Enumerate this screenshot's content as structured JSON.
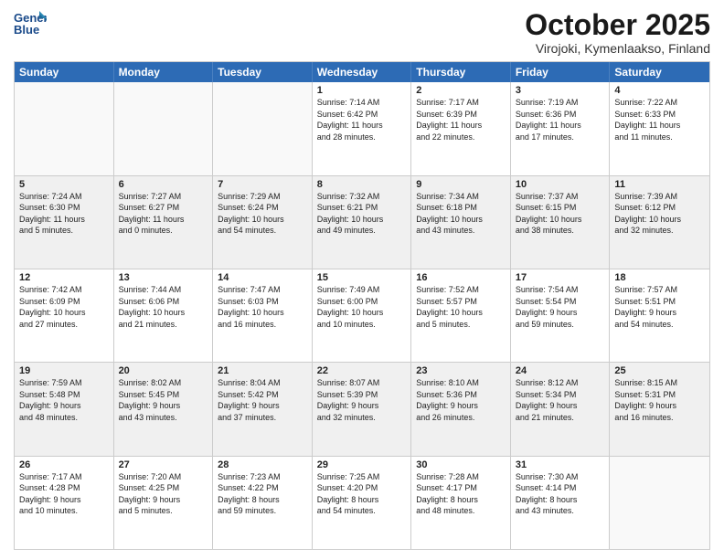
{
  "header": {
    "logo_line1": "General",
    "logo_line2": "Blue",
    "month": "October 2025",
    "location": "Virojoki, Kymenlaakso, Finland"
  },
  "days": [
    "Sunday",
    "Monday",
    "Tuesday",
    "Wednesday",
    "Thursday",
    "Friday",
    "Saturday"
  ],
  "rows": [
    [
      {
        "num": "",
        "text": ""
      },
      {
        "num": "",
        "text": ""
      },
      {
        "num": "",
        "text": ""
      },
      {
        "num": "1",
        "text": "Sunrise: 7:14 AM\nSunset: 6:42 PM\nDaylight: 11 hours\nand 28 minutes."
      },
      {
        "num": "2",
        "text": "Sunrise: 7:17 AM\nSunset: 6:39 PM\nDaylight: 11 hours\nand 22 minutes."
      },
      {
        "num": "3",
        "text": "Sunrise: 7:19 AM\nSunset: 6:36 PM\nDaylight: 11 hours\nand 17 minutes."
      },
      {
        "num": "4",
        "text": "Sunrise: 7:22 AM\nSunset: 6:33 PM\nDaylight: 11 hours\nand 11 minutes."
      }
    ],
    [
      {
        "num": "5",
        "text": "Sunrise: 7:24 AM\nSunset: 6:30 PM\nDaylight: 11 hours\nand 5 minutes."
      },
      {
        "num": "6",
        "text": "Sunrise: 7:27 AM\nSunset: 6:27 PM\nDaylight: 11 hours\nand 0 minutes."
      },
      {
        "num": "7",
        "text": "Sunrise: 7:29 AM\nSunset: 6:24 PM\nDaylight: 10 hours\nand 54 minutes."
      },
      {
        "num": "8",
        "text": "Sunrise: 7:32 AM\nSunset: 6:21 PM\nDaylight: 10 hours\nand 49 minutes."
      },
      {
        "num": "9",
        "text": "Sunrise: 7:34 AM\nSunset: 6:18 PM\nDaylight: 10 hours\nand 43 minutes."
      },
      {
        "num": "10",
        "text": "Sunrise: 7:37 AM\nSunset: 6:15 PM\nDaylight: 10 hours\nand 38 minutes."
      },
      {
        "num": "11",
        "text": "Sunrise: 7:39 AM\nSunset: 6:12 PM\nDaylight: 10 hours\nand 32 minutes."
      }
    ],
    [
      {
        "num": "12",
        "text": "Sunrise: 7:42 AM\nSunset: 6:09 PM\nDaylight: 10 hours\nand 27 minutes."
      },
      {
        "num": "13",
        "text": "Sunrise: 7:44 AM\nSunset: 6:06 PM\nDaylight: 10 hours\nand 21 minutes."
      },
      {
        "num": "14",
        "text": "Sunrise: 7:47 AM\nSunset: 6:03 PM\nDaylight: 10 hours\nand 16 minutes."
      },
      {
        "num": "15",
        "text": "Sunrise: 7:49 AM\nSunset: 6:00 PM\nDaylight: 10 hours\nand 10 minutes."
      },
      {
        "num": "16",
        "text": "Sunrise: 7:52 AM\nSunset: 5:57 PM\nDaylight: 10 hours\nand 5 minutes."
      },
      {
        "num": "17",
        "text": "Sunrise: 7:54 AM\nSunset: 5:54 PM\nDaylight: 9 hours\nand 59 minutes."
      },
      {
        "num": "18",
        "text": "Sunrise: 7:57 AM\nSunset: 5:51 PM\nDaylight: 9 hours\nand 54 minutes."
      }
    ],
    [
      {
        "num": "19",
        "text": "Sunrise: 7:59 AM\nSunset: 5:48 PM\nDaylight: 9 hours\nand 48 minutes."
      },
      {
        "num": "20",
        "text": "Sunrise: 8:02 AM\nSunset: 5:45 PM\nDaylight: 9 hours\nand 43 minutes."
      },
      {
        "num": "21",
        "text": "Sunrise: 8:04 AM\nSunset: 5:42 PM\nDaylight: 9 hours\nand 37 minutes."
      },
      {
        "num": "22",
        "text": "Sunrise: 8:07 AM\nSunset: 5:39 PM\nDaylight: 9 hours\nand 32 minutes."
      },
      {
        "num": "23",
        "text": "Sunrise: 8:10 AM\nSunset: 5:36 PM\nDaylight: 9 hours\nand 26 minutes."
      },
      {
        "num": "24",
        "text": "Sunrise: 8:12 AM\nSunset: 5:34 PM\nDaylight: 9 hours\nand 21 minutes."
      },
      {
        "num": "25",
        "text": "Sunrise: 8:15 AM\nSunset: 5:31 PM\nDaylight: 9 hours\nand 16 minutes."
      }
    ],
    [
      {
        "num": "26",
        "text": "Sunrise: 7:17 AM\nSunset: 4:28 PM\nDaylight: 9 hours\nand 10 minutes."
      },
      {
        "num": "27",
        "text": "Sunrise: 7:20 AM\nSunset: 4:25 PM\nDaylight: 9 hours\nand 5 minutes."
      },
      {
        "num": "28",
        "text": "Sunrise: 7:23 AM\nSunset: 4:22 PM\nDaylight: 8 hours\nand 59 minutes."
      },
      {
        "num": "29",
        "text": "Sunrise: 7:25 AM\nSunset: 4:20 PM\nDaylight: 8 hours\nand 54 minutes."
      },
      {
        "num": "30",
        "text": "Sunrise: 7:28 AM\nSunset: 4:17 PM\nDaylight: 8 hours\nand 48 minutes."
      },
      {
        "num": "31",
        "text": "Sunrise: 7:30 AM\nSunset: 4:14 PM\nDaylight: 8 hours\nand 43 minutes."
      },
      {
        "num": "",
        "text": ""
      }
    ]
  ]
}
